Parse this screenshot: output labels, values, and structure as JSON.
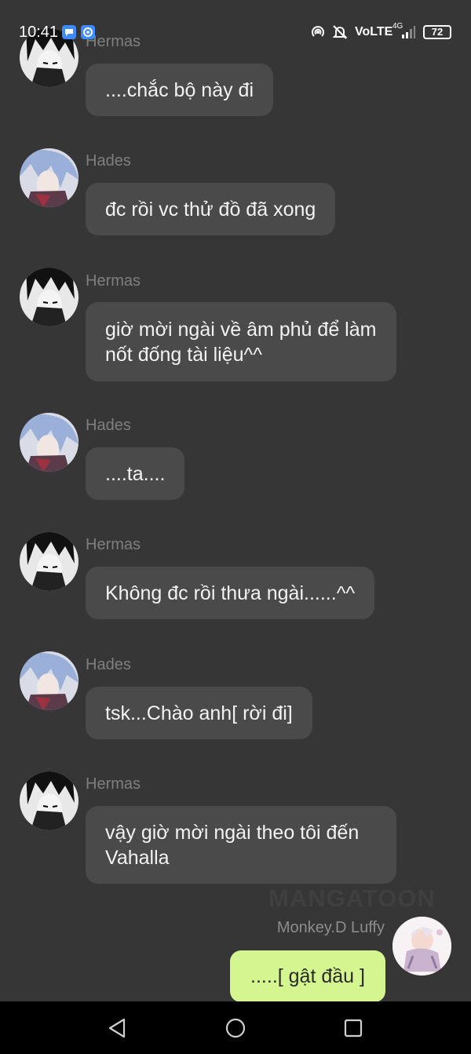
{
  "status_bar": {
    "time": "10:41",
    "network": "VoLTE",
    "signal": "4G",
    "battery": "72"
  },
  "messages": [
    {
      "sender": "Hermas",
      "text": "....chắc bộ này đi",
      "avatar": "hermas-avatar"
    },
    {
      "sender": "Hades",
      "text": "đc rồi vc thử đồ đã xong",
      "avatar": "hades-avatar"
    },
    {
      "sender": "Hermas",
      "text": "giờ mời ngài về âm phủ để làm nốt đống tài liệu^^",
      "avatar": "hermas-avatar"
    },
    {
      "sender": "Hades",
      "text": "....ta....",
      "avatar": "hades-avatar"
    },
    {
      "sender": "Hermas",
      "text": "Không đc rồi thưa ngài......^^",
      "avatar": "hermas-avatar"
    },
    {
      "sender": "Hades",
      "text": "tsk...Chào anh[ rời đi]",
      "avatar": "hades-avatar"
    },
    {
      "sender": "Hermas",
      "text": "vậy giờ mời ngài theo tôi đến Vahalla",
      "avatar": "hermas-avatar"
    }
  ],
  "self_message": {
    "sender": "Monkey.D Luffy",
    "text": ".....[ gật đầu ]"
  },
  "watermark": "MANGATOON",
  "colors": {
    "background": "#363636",
    "bubble": "#4a4a4a",
    "self_bubble": "#d4f58f",
    "sender_name": "#7f7f7f",
    "nav_bar": "#000000"
  },
  "nav": {
    "back_icon": "triangle-back-icon",
    "home_icon": "circle-home-icon",
    "recents_icon": "square-recents-icon"
  }
}
